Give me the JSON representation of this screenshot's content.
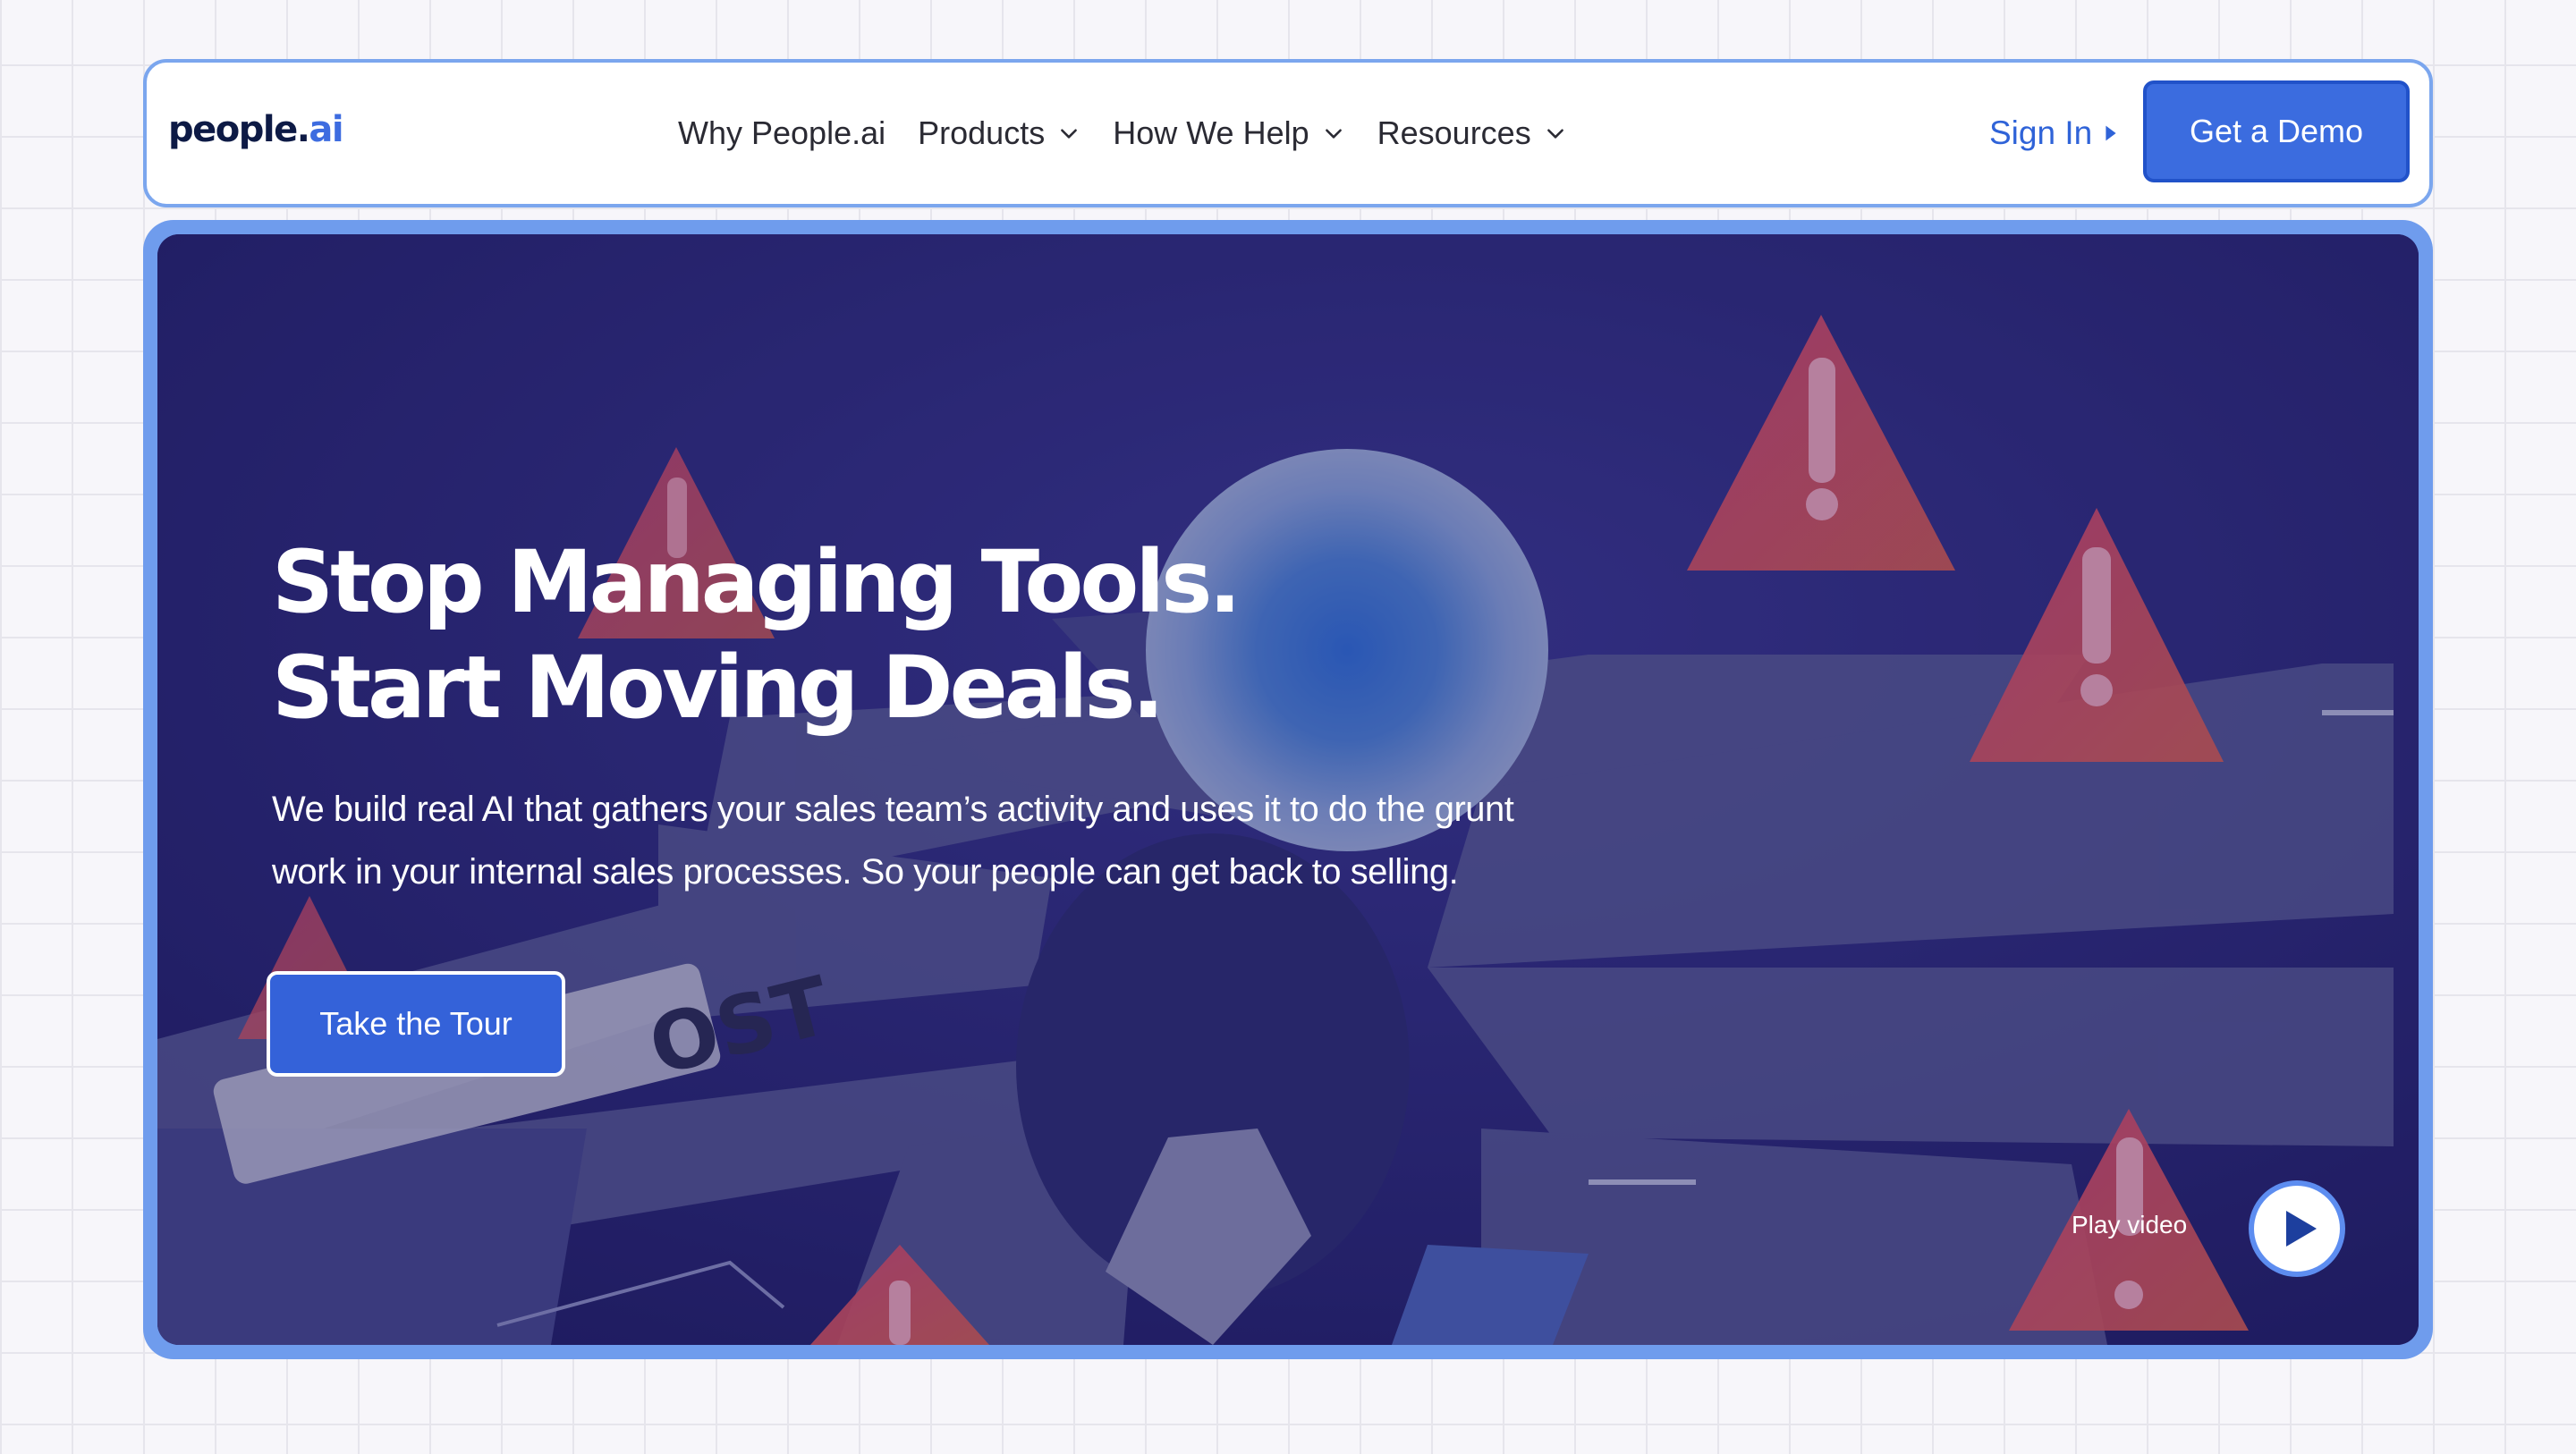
{
  "brand": {
    "logo_main": "people.",
    "logo_accent": "ai"
  },
  "nav": {
    "items": [
      {
        "label": "Why People.ai",
        "dropdown": false
      },
      {
        "label": "Products",
        "dropdown": true
      },
      {
        "label": "How We Help",
        "dropdown": true
      },
      {
        "label": "Resources",
        "dropdown": true
      }
    ],
    "sign_in": "Sign In",
    "demo": "Get a Demo"
  },
  "hero": {
    "title_line1": "Stop Managing Tools.",
    "title_line2": "Start Moving Deals.",
    "description_line1": "We build real AI that gathers your sales team’s activity and uses it to do the grunt",
    "description_line2": "work in your internal sales processes. So your people can get back to selling.",
    "cta": "Take the Tour",
    "play_label": "Play video",
    "background_sign_text": "OST"
  },
  "colors": {
    "accent": "#3b6cdf",
    "frame": "#7ba6ee",
    "hero_bg": "#26236b",
    "warning": "#e04a52"
  },
  "icons": {
    "nav_dropdown": "chevron-down-icon",
    "sign_in": "caret-right-icon",
    "play": "play-icon",
    "warning": "warning-triangle-icon"
  }
}
